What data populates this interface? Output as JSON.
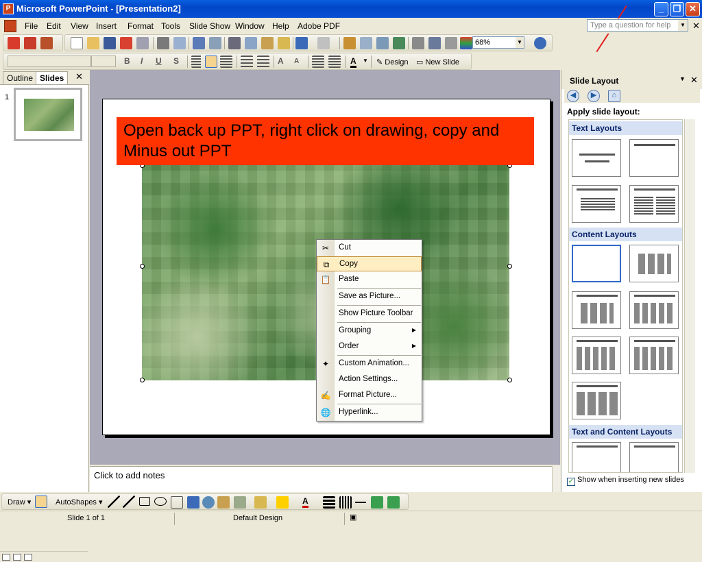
{
  "window": {
    "title": "Microsoft PowerPoint - [Presentation2]"
  },
  "menubar": {
    "items": [
      "File",
      "Edit",
      "View",
      "Insert",
      "Format",
      "Tools",
      "Slide Show",
      "Window",
      "Help",
      "Adobe PDF"
    ],
    "help_placeholder": "Type a question for help"
  },
  "toolbar": {
    "zoom": "68%",
    "design_label": "Design",
    "new_slide_label": "New Slide"
  },
  "left_panel": {
    "tabs": [
      "Outline",
      "Slides"
    ],
    "slide_number": "1"
  },
  "slide": {
    "title": "Open back up PPT, right click on drawing, copy and Minus out PPT"
  },
  "notes": {
    "placeholder": "Click to add notes"
  },
  "context_menu": {
    "items": [
      {
        "label": "Cut",
        "icon": "scissors-icon",
        "submenu": false
      },
      {
        "label": "Copy",
        "icon": "copy-icon",
        "submenu": false,
        "highlighted": true
      },
      {
        "label": "Paste",
        "icon": "paste-icon",
        "submenu": false
      },
      {
        "label": "Save as Picture...",
        "icon": "",
        "submenu": false
      },
      {
        "label": "Show Picture Toolbar",
        "icon": "",
        "submenu": false
      },
      {
        "label": "Grouping",
        "icon": "",
        "submenu": true
      },
      {
        "label": "Order",
        "icon": "",
        "submenu": true
      },
      {
        "label": "Custom Animation...",
        "icon": "animation-icon",
        "submenu": false
      },
      {
        "label": "Action Settings...",
        "icon": "",
        "submenu": false
      },
      {
        "label": "Format Picture...",
        "icon": "format-picture-icon",
        "submenu": false
      },
      {
        "label": "Hyperlink...",
        "icon": "hyperlink-icon",
        "submenu": false
      }
    ]
  },
  "task_pane": {
    "title": "Slide Layout",
    "apply_label": "Apply slide layout:",
    "sections": [
      "Text Layouts",
      "Content Layouts",
      "Text and Content Layouts"
    ],
    "checkbox_label": "Show when inserting new slides",
    "checkbox_checked": true
  },
  "drawbar": {
    "draw_label": "Draw",
    "autoshapes_label": "AutoShapes"
  },
  "statusbar": {
    "slide_info": "Slide 1 of 1",
    "design": "Default Design"
  },
  "colors": {
    "title_bar": "#0a4fd4",
    "slide_title_fill": "#ff3300",
    "menu_highlight": "#ffeec2"
  }
}
